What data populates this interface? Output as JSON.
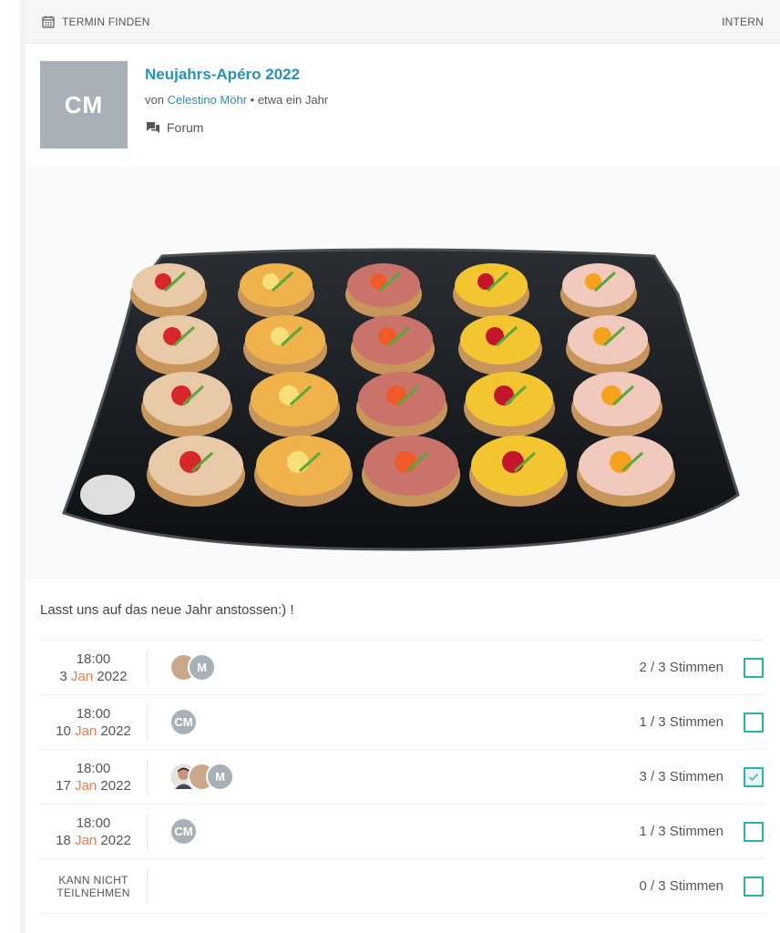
{
  "header": {
    "title": "TERMIN FINDEN",
    "right_label": "INTERN"
  },
  "post": {
    "author_initials": "CM",
    "title": "Neujahrs-Apéro 2022",
    "by_prefix": "von",
    "author_name": "Celestino Möhr",
    "separator": " • ",
    "time_ago": "etwa ein Jahr",
    "forum_label": "Forum",
    "description": "Lasst uns auf das neue Jahr anstossen:) !"
  },
  "options": [
    {
      "time": "18:00",
      "day": "3",
      "month": "Jan",
      "year": "2022",
      "votes": "2 / 3 Stimmen",
      "checked": false,
      "avatars": [
        "photo-blond",
        "M"
      ]
    },
    {
      "time": "18:00",
      "day": "10",
      "month": "Jan",
      "year": "2022",
      "votes": "1 / 3 Stimmen",
      "checked": false,
      "avatars": [
        "CM"
      ]
    },
    {
      "time": "18:00",
      "day": "17",
      "month": "Jan",
      "year": "2022",
      "votes": "3 / 3 Stimmen",
      "checked": true,
      "avatars": [
        "photo-man",
        "photo-blond",
        "M"
      ]
    },
    {
      "time": "18:00",
      "day": "18",
      "month": "Jan",
      "year": "2022",
      "votes": "1 / 3 Stimmen",
      "checked": false,
      "avatars": [
        "CM"
      ]
    }
  ],
  "cannot_attend": {
    "line1": "KANN NICHT",
    "line2": "TEILNEHMEN",
    "votes": "0 / 3 Stimmen",
    "checked": false
  },
  "colors": {
    "link": "#2a8fbd",
    "accent_month": "#ef7a4b",
    "checkbox": "#27b4a8",
    "avatar_gray": "#a8b0b8"
  },
  "icons": {
    "header": "calendar-icon",
    "forum": "chat-bubbles-icon",
    "check": "checkmark-icon"
  }
}
